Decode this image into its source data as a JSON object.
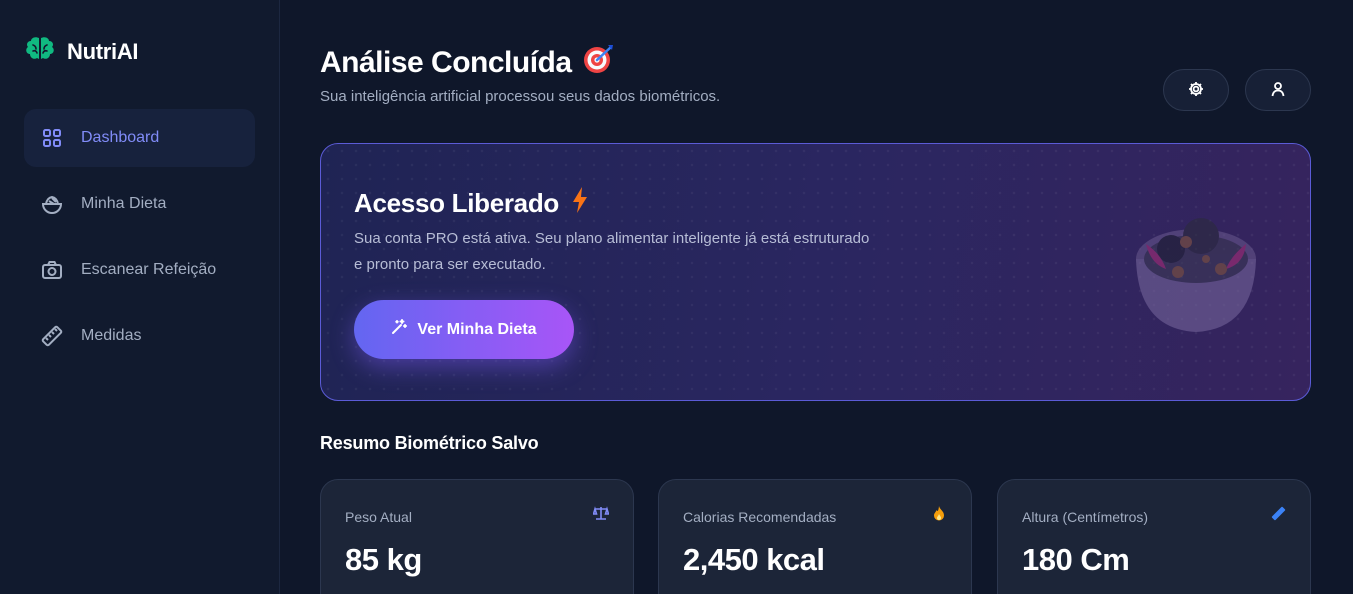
{
  "brand": {
    "name": "NutriAI",
    "icon": "brain-icon",
    "color": "#10b981"
  },
  "sidebar": {
    "items": [
      {
        "label": "Dashboard",
        "icon": "grid-icon",
        "active": true
      },
      {
        "label": "Minha Dieta",
        "icon": "bowl-icon",
        "active": false
      },
      {
        "label": "Escanear Refeição",
        "icon": "camera-icon",
        "active": false
      },
      {
        "label": "Medidas",
        "icon": "ruler-icon",
        "active": false
      }
    ]
  },
  "header": {
    "title": "Análise Concluída",
    "title_emoji": "🎯",
    "subtitle": "Sua inteligência artificial processou seus dados biométricos.",
    "buttons": [
      {
        "icon": "gear-icon"
      },
      {
        "icon": "user-icon"
      }
    ]
  },
  "banner": {
    "title": "Acesso Liberado",
    "title_icon": "bolt-icon",
    "text": "Sua conta PRO está ativa. Seu plano alimentar inteligente já está estruturado e pronto para ser executado.",
    "cta_label": "Ver Minha Dieta",
    "cta_icon": "magic-wand-icon",
    "accent": "#6366f1",
    "accent2": "#a855f7"
  },
  "summary": {
    "title": "Resumo Biométrico Salvo",
    "cards": [
      {
        "label": "Peso Atual",
        "value": "85 kg",
        "icon": "scale-icon",
        "icon_color": "#818cf8"
      },
      {
        "label": "Calorias Recomendadas",
        "value": "2,450 kcal",
        "icon": "fire-icon",
        "icon_color": "#f59e0b"
      },
      {
        "label": "Altura (Centímetros)",
        "value": "180 Cm",
        "icon": "ruler-icon",
        "icon_color": "#3b82f6"
      }
    ]
  }
}
